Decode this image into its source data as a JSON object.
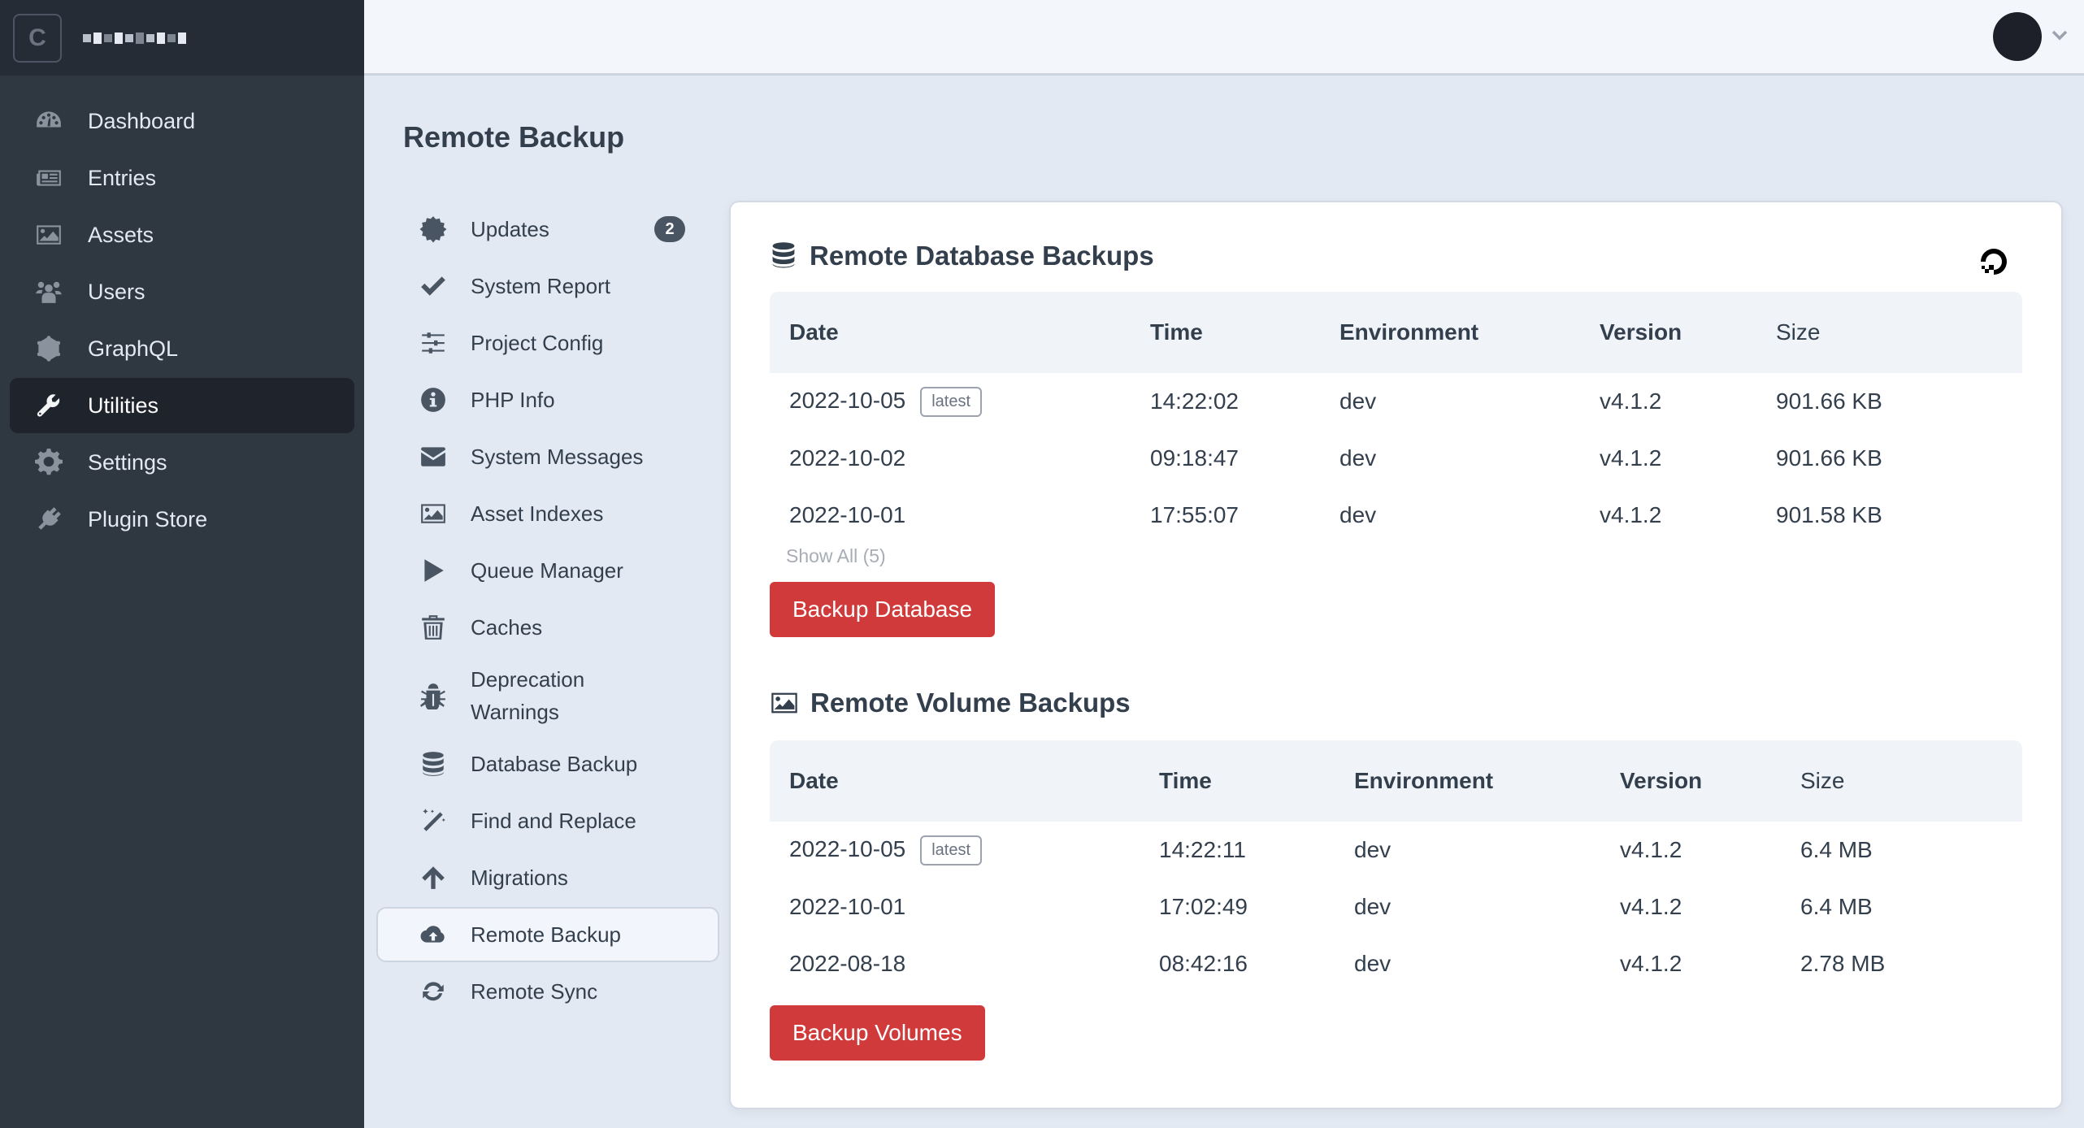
{
  "app": {
    "logo_letter": "C",
    "site_name_obscured": true
  },
  "sidebar": {
    "items": [
      {
        "label": "Dashboard",
        "icon": "gauge-icon"
      },
      {
        "label": "Entries",
        "icon": "newspaper-icon"
      },
      {
        "label": "Assets",
        "icon": "image-icon"
      },
      {
        "label": "Users",
        "icon": "users-icon"
      },
      {
        "label": "GraphQL",
        "icon": "graphql-icon"
      },
      {
        "label": "Utilities",
        "icon": "wrench-icon",
        "active": true
      },
      {
        "label": "Settings",
        "icon": "gear-icon"
      },
      {
        "label": "Plugin Store",
        "icon": "plug-icon"
      }
    ]
  },
  "header": {
    "user_menu_icon": "chevron-down-icon"
  },
  "page": {
    "title": "Remote Backup"
  },
  "subnav": {
    "items": [
      {
        "label": "Updates",
        "icon": "badge-icon",
        "count": "2"
      },
      {
        "label": "System Report",
        "icon": "check-icon"
      },
      {
        "label": "Project Config",
        "icon": "sliders-icon"
      },
      {
        "label": "PHP Info",
        "icon": "info-icon"
      },
      {
        "label": "System Messages",
        "icon": "envelope-icon"
      },
      {
        "label": "Asset Indexes",
        "icon": "image-icon"
      },
      {
        "label": "Queue Manager",
        "icon": "play-icon"
      },
      {
        "label": "Caches",
        "icon": "trash-icon"
      },
      {
        "label": "Deprecation Warnings",
        "label_line1": "Deprecation",
        "label_line2": "Warnings",
        "icon": "bug-icon"
      },
      {
        "label": "Database Backup",
        "icon": "database-icon"
      },
      {
        "label": "Find and Replace",
        "icon": "magic-wand-icon"
      },
      {
        "label": "Migrations",
        "icon": "arrow-up-icon"
      },
      {
        "label": "Remote Backup",
        "icon": "cloud-upload-icon",
        "active": true
      },
      {
        "label": "Remote Sync",
        "icon": "sync-icon"
      }
    ]
  },
  "card": {
    "provider_logo": "digitalocean-logo-icon",
    "database": {
      "title": "Remote Database Backups",
      "icon": "database-icon",
      "columns": [
        "Date",
        "Time",
        "Environment",
        "Version",
        "Size"
      ],
      "rows": [
        {
          "date": "2022-10-05",
          "tag": "latest",
          "time": "14:22:02",
          "env": "dev",
          "version": "v4.1.2",
          "size": "901.66 KB"
        },
        {
          "date": "2022-10-02",
          "time": "09:18:47",
          "env": "dev",
          "version": "v4.1.2",
          "size": "901.66 KB"
        },
        {
          "date": "2022-10-01",
          "time": "17:55:07",
          "env": "dev",
          "version": "v4.1.2",
          "size": "901.58 KB"
        }
      ],
      "show_all": "Show All (5)",
      "button": "Backup Database"
    },
    "volumes": {
      "title": "Remote Volume Backups",
      "icon": "image-icon",
      "columns": [
        "Date",
        "Time",
        "Environment",
        "Version",
        "Size"
      ],
      "rows": [
        {
          "date": "2022-10-05",
          "tag": "latest",
          "time": "14:22:11",
          "env": "dev",
          "version": "v4.1.2",
          "size": "6.4 MB"
        },
        {
          "date": "2022-10-01",
          "time": "17:02:49",
          "env": "dev",
          "version": "v4.1.2",
          "size": "6.4 MB"
        },
        {
          "date": "2022-08-18",
          "time": "08:42:16",
          "env": "dev",
          "version": "v4.1.2",
          "size": "2.78 MB"
        }
      ],
      "button": "Backup Volumes"
    }
  },
  "colors": {
    "sidebar_bg": "#2f3741",
    "sidebar_head_bg": "#262c36",
    "page_bg": "#e3e9f2",
    "primary_button": "#d13a3a",
    "text": "#333f4d"
  }
}
